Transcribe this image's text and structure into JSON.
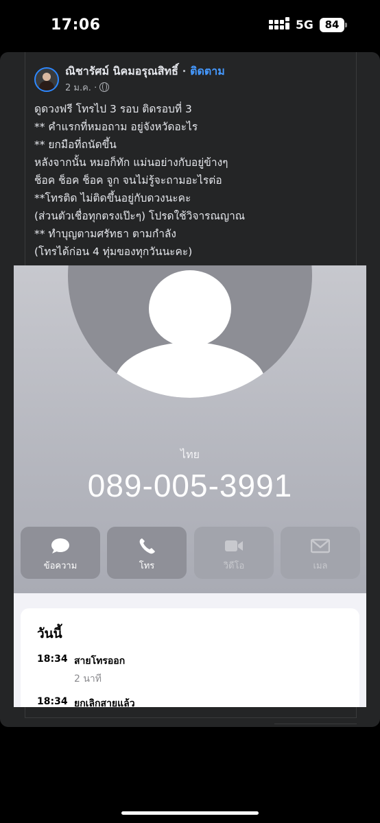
{
  "status_bar": {
    "time": "17:06",
    "network": "5G",
    "battery": "84",
    "signal_icon": "signal-bars-icon"
  },
  "post": {
    "author": "ณิชารัศม์ นิคมอรุณสิทธิ์",
    "separator": "·",
    "follow_label": "ติดตาม",
    "date": "2 ม.ค.",
    "date_separator": "·",
    "audience_icon": "globe-icon",
    "lines": [
      "ดูดวงฟรี โทรไป 3 รอบ ติดรอบที่ 3",
      "** คำแรกที่หมอถาม อยู่จังหวัดอะไร",
      "** ยกมือที่ถนัดขึ้น",
      "หลังจากนั้น หมอก็ทัก แม่นอย่างกับอยู่ข้างๆ",
      "ช็อค ช็อค ช็อค จูก จนไม่รู้จะถามอะไรต่อ",
      "**โทรติด ไม่ติดขึ้นอยู่กับดวงนะคะ",
      "(ส่วนตัวเชื่อทุกตรงเป๊ะๆ) โปรดใช้วิจารณญาณ",
      "** ทำบุญตามศรัทธา ตามกำลัง",
      "(โทรได้ก่อน 4 ทุ่มของทุกวันนะคะ)"
    ]
  },
  "contact": {
    "country": "ไทย",
    "number": "089-005-3991",
    "actions": [
      {
        "label": "ข้อความ",
        "icon": "message-bubble-icon",
        "enabled": true
      },
      {
        "label": "โทร",
        "icon": "phone-icon",
        "enabled": true
      },
      {
        "label": "วิดีโอ",
        "icon": "video-icon",
        "enabled": false
      },
      {
        "label": "เมล",
        "icon": "mail-icon",
        "enabled": false
      }
    ]
  },
  "history": {
    "heading": "วันนี้",
    "calls": [
      {
        "time": "18:34",
        "type": "สายโทรออก",
        "duration": "2 นาที"
      },
      {
        "time": "18:34",
        "type": "ยกเลิกสายแล้ว",
        "duration": ""
      }
    ]
  },
  "colors": {
    "background": "#000000",
    "card": "#242526",
    "link": "#4599ff",
    "contact_header": "#a9abb4"
  }
}
